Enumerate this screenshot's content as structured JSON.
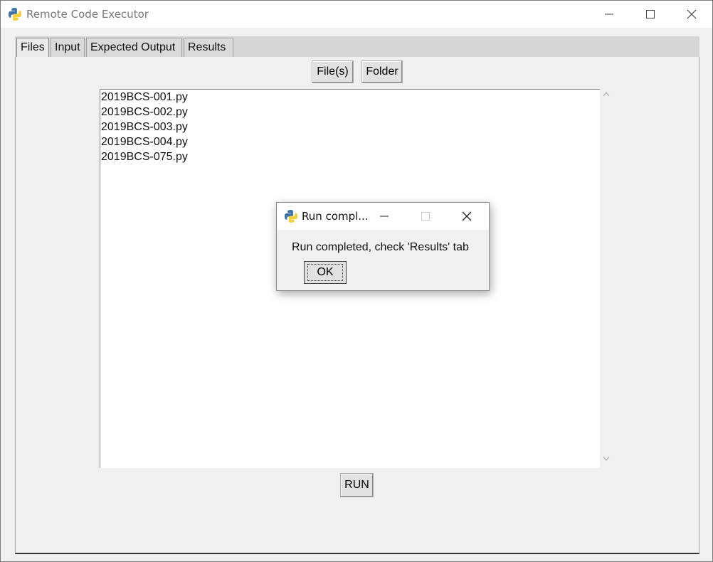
{
  "window": {
    "title": "Remote Code Executor",
    "icon": "python-icon"
  },
  "tabs": [
    {
      "label": "Files",
      "active": true
    },
    {
      "label": "Input",
      "active": false
    },
    {
      "label": "Expected Output",
      "active": false
    },
    {
      "label": "Results",
      "active": false
    }
  ],
  "files_tab": {
    "files_button": "File(s)",
    "folder_button": "Folder",
    "file_list": [
      "2019BCS-001.py",
      "2019BCS-002.py",
      "2019BCS-003.py",
      "2019BCS-004.py",
      "2019BCS-075.py"
    ],
    "run_button": "RUN"
  },
  "dialog": {
    "title": "Run compl...",
    "message": "Run completed, check 'Results' tab",
    "ok_button": "OK",
    "icon": "python-icon"
  }
}
